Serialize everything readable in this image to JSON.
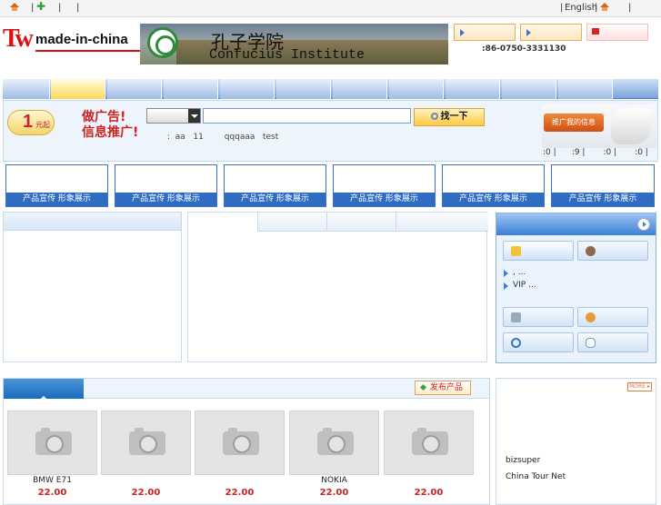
{
  "topbar": {
    "left_sep": "|",
    "english": "English",
    "pipe": "|"
  },
  "logo": {
    "tw": "Tw",
    "text": "made-in-china"
  },
  "banner": {
    "cn": "孔子学院",
    "en": "Confucius Institute"
  },
  "phone": ":86-0750-3331130",
  "search": {
    "button_label": "找一下",
    "hotwords": ":  aa   11        qqqaaa   test"
  },
  "ad": {
    "one": "1",
    "one_sub": "元起",
    "line1": "做广告!",
    "line2": "信息推广!",
    "promo_button": "推广我的信息"
  },
  "stats": ":0 |      :9 |       :0 |       :0 |       :0",
  "product_banners": [
    "产品宣传 形象展示",
    "产品宣传 形象展示",
    "产品宣传 形象展示",
    "产品宣传 形象展示",
    "产品宣传 形象展示",
    "产品宣传 形象展示"
  ],
  "right_panel": {
    "list": [
      ",      ...",
      "VIP          ..."
    ]
  },
  "products_panel": {
    "publish_button": "发布产品",
    "items": [
      {
        "name": "BMW    E71",
        "price": "22.00"
      },
      {
        "name": "",
        "price": "22.00"
      },
      {
        "name": "",
        "price": "22.00"
      },
      {
        "name": "NOKIA",
        "price": "22.00"
      },
      {
        "name": "",
        "price": "22.00"
      }
    ]
  },
  "right_bottom": {
    "more": "MORE ▸",
    "links": [
      "bizsuper",
      "China Tour Net"
    ]
  }
}
